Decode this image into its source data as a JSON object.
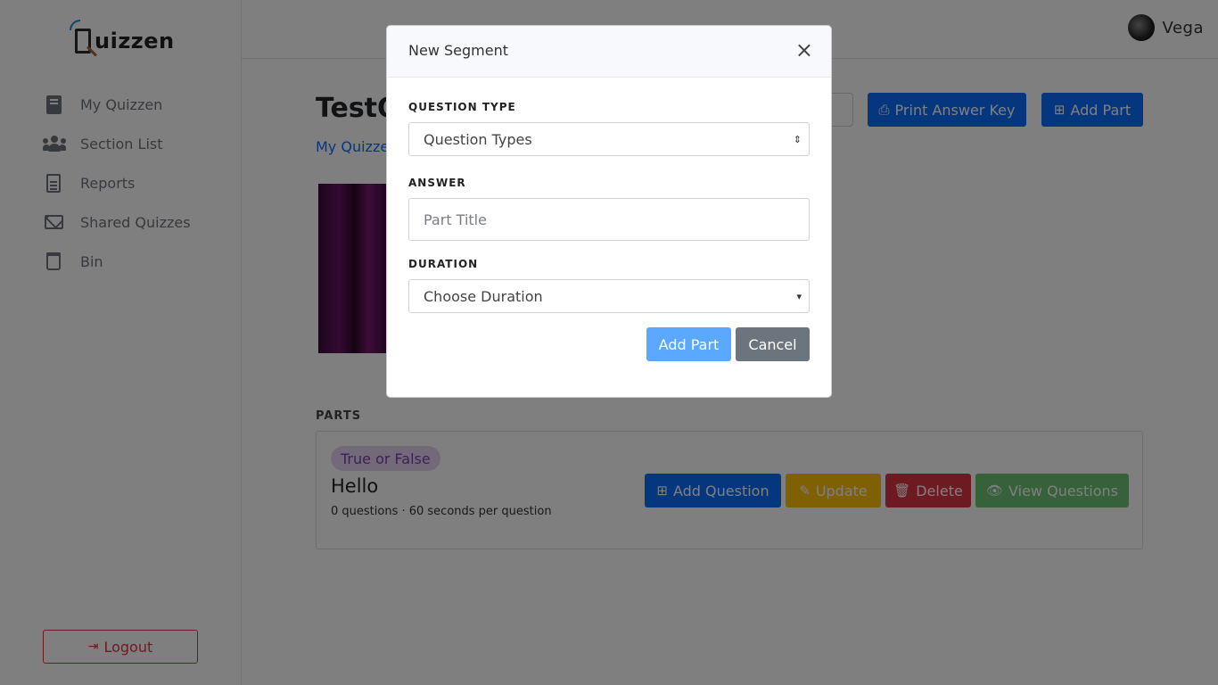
{
  "app": {
    "logo_text": "uizzen"
  },
  "sidebar": {
    "items": [
      {
        "label": "My Quizzen",
        "icon": "book-icon"
      },
      {
        "label": "Section List",
        "icon": "users-icon"
      },
      {
        "label": "Reports",
        "icon": "file-icon"
      },
      {
        "label": "Shared Quizzes",
        "icon": "envelope-icon"
      },
      {
        "label": "Bin",
        "icon": "trash-icon"
      }
    ],
    "logout_label": "Logout"
  },
  "topbar": {
    "username": "Vega"
  },
  "page": {
    "title": "TestQ",
    "breadcrumb": "My Quizze",
    "print_button": "Print Answer Key",
    "add_part_button": "Add Part",
    "parts_heading": "PARTS"
  },
  "part": {
    "badge": "True or False",
    "name": "Hello",
    "meta": "0 questions · 60 seconds per question",
    "buttons": {
      "add_question": "Add Question",
      "update": "Update",
      "delete": "Delete",
      "view": "View Questions"
    }
  },
  "modal": {
    "title": "New Segment",
    "close": "×",
    "question_type_label": "QUESTION TYPE",
    "question_type_value": "Question Types",
    "answer_label": "ANSWER",
    "answer_placeholder": "Part Title",
    "duration_label": "DURATION",
    "duration_value": "Choose Duration",
    "add_button": "Add Part",
    "cancel_button": "Cancel"
  },
  "colors": {
    "primary": "#0d6efd",
    "warning": "#ffc107",
    "danger": "#dc3545",
    "success": "#6fc276",
    "secondary": "#6c757d",
    "badge_bg": "#e6d5f3"
  }
}
